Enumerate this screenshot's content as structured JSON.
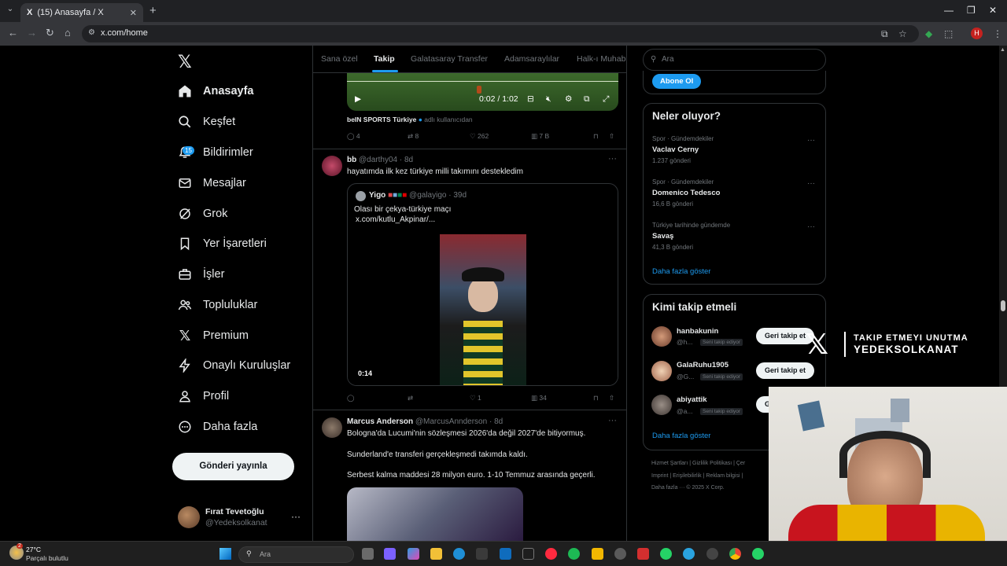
{
  "browser": {
    "tab_title": "(15) Anasayfa / X",
    "url": "x.com/home",
    "profile_initial": "H"
  },
  "sidebar": {
    "items": [
      {
        "label": "Anasayfa",
        "icon": "home-icon"
      },
      {
        "label": "Keşfet",
        "icon": "search-icon"
      },
      {
        "label": "Bildirimler",
        "icon": "bell-icon",
        "badge": "15"
      },
      {
        "label": "Mesajlar",
        "icon": "mail-icon"
      },
      {
        "label": "Grok",
        "icon": "grok-icon"
      },
      {
        "label": "Yer İşaretleri",
        "icon": "bookmark-icon"
      },
      {
        "label": "İşler",
        "icon": "briefcase-icon"
      },
      {
        "label": "Topluluklar",
        "icon": "people-icon"
      },
      {
        "label": "Premium",
        "icon": "x-icon"
      },
      {
        "label": "Onaylı Kuruluşlar",
        "icon": "lightning-icon"
      },
      {
        "label": "Profil",
        "icon": "person-icon"
      },
      {
        "label": "Daha fazla",
        "icon": "more-circle-icon"
      }
    ],
    "post_button": "Gönderi yayınla",
    "user": {
      "name": "Fırat Tevetoğlu",
      "handle": "@Yedeksolkanat"
    }
  },
  "feed": {
    "tabs": [
      "Sana özel",
      "Takip",
      "Galatasaray Transfer",
      "Adamsaraylılar",
      "Halk-ı Muhab"
    ],
    "active_tab": 1,
    "post0": {
      "video_time": "0:02 / 1:02",
      "source_name": "beIN SPORTS Türkiye",
      "source_suffix": "adlı kullanıcıdan",
      "replies": "4",
      "reposts": "8",
      "likes": "262",
      "views": "7 B"
    },
    "post1": {
      "name": "bb",
      "handle": "@darthy04",
      "time": "· 8d",
      "text": "hayatımda ilk kez türkiye milli takımını destekledim",
      "quote": {
        "name": "Yigo",
        "handle": "@galayigo",
        "time": "· 39d",
        "text1": "Olası bir çekya-türkiye maçı",
        "text2": "x.com/kutlu_Akpinar/...",
        "video_time": "0:14"
      },
      "replies": "",
      "reposts": "",
      "likes": "1",
      "views": "34"
    },
    "post2": {
      "name": "Marcus Anderson",
      "handle": "@MarcusAnnderson",
      "time": "· 8d",
      "line1": "Bologna'da Lucumi'nin sözleşmesi 2026'da değil 2027'de bitiyormuş.",
      "line2": "Sunderland'e transferi gerçekleşmedi takımda kaldı.",
      "line3": "Serbest kalma maddesi 28 milyon euro. 1-10 Temmuz arasında geçerli."
    }
  },
  "right": {
    "search_placeholder": "Ara",
    "subscribe_button": "Abone Ol",
    "trends_title": "Neler oluyor?",
    "trends": [
      {
        "context": "Spor · Gündemdekiler",
        "name": "Vaclav Cerny",
        "count": "1.237 gönderi"
      },
      {
        "context": "Spor · Gündemdekiler",
        "name": "Domenico Tedesco",
        "count": "16,6 B gönderi"
      },
      {
        "context": "Türkiye tarihinde gündemde",
        "name": "Savaş",
        "count": "41,3 B gönderi"
      }
    ],
    "show_more": "Daha fazla göster",
    "wtf_title": "Kimi takip etmeli",
    "wtf": [
      {
        "name": "hanbakunin",
        "handle": "@h...",
        "follows_you": "Seni takip ediyor",
        "button": "Geri takip et"
      },
      {
        "name": "GalaRuhu1905",
        "handle": "@G...",
        "follows_you": "Seni takip ediyor",
        "button": "Geri takip et"
      },
      {
        "name": "abiyattik",
        "handle": "@a...",
        "follows_you": "Seni takip ediyor",
        "button": "Geri takip et"
      }
    ],
    "wtf_more": "Daha fazla göster",
    "footer": {
      "row1": "Hizmet Şartları  |  Gizlilik Politikası  |  Çer",
      "row2": "Imprint  |  Erişilebilirlik  |  Reklam bilgisi  |",
      "row3": "Daha fazla ···  © 2025 X Corp."
    }
  },
  "overlay": {
    "line1": "TAKIP ETMEYI UNUTMA",
    "line2": "YEDEKSOLKANAT"
  },
  "taskbar": {
    "temperature": "27°C",
    "weather": "Parçalı bulutlu",
    "search_placeholder": "Ara",
    "weather_badge": "2"
  },
  "colors": {
    "accent": "#1d9bf0",
    "background": "#000000",
    "border": "#2f3336"
  }
}
